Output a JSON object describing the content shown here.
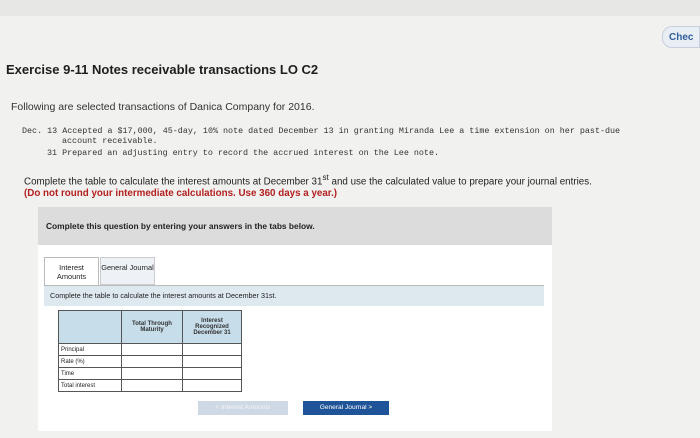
{
  "top": {
    "check_label": "Chec"
  },
  "exercise": {
    "title": "Exercise 9-11 Notes receivable transactions LO C2",
    "intro": "Following are selected transactions of Danica Company for 2016.",
    "lines": [
      "Dec. 13 Accepted a $17,000, 45-day, 10% note dated December 13 in granting Miranda Lee a time extension on her past-due",
      "account receivable.",
      "31 Prepared an adjusting entry to record the accrued interest on the Lee note."
    ]
  },
  "instructions": {
    "line1_a": "Complete the table to calculate the interest amounts at December 31",
    "line1_sup": "st",
    "line1_b": " and use the calculated value to prepare your journal entries.",
    "line2": "(Do not round your intermediate calculations. Use 360 days a year.)"
  },
  "panel": {
    "heading": "Complete this question by entering your answers in the tabs below.",
    "tabs": [
      "Interest Amounts",
      "General Journal"
    ],
    "tab_instruction": "Complete the table to calculate the interest amounts at December 31st.",
    "table": {
      "col_headers": [
        "",
        "Total Through Maturity",
        "Interest Recognized December 31"
      ],
      "rows": [
        "Principal",
        "Rate (%)",
        "Time",
        "Total interest"
      ]
    },
    "nav": {
      "prev": "< Interest Amounts",
      "next": "General Journal >"
    }
  }
}
